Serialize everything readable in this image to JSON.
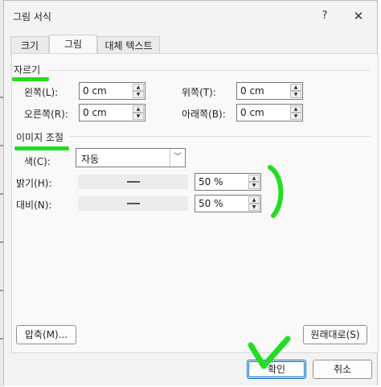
{
  "dialog": {
    "title": "그림 서식",
    "help_label": "?",
    "close_label": "✕"
  },
  "tabs": [
    {
      "label": "크기",
      "active": false
    },
    {
      "label": "그림",
      "active": true
    },
    {
      "label": "대체 텍스트",
      "active": false
    }
  ],
  "crop": {
    "title": "자르기",
    "left_label": "왼쪽(L):",
    "left_value": "0 cm",
    "top_label": "위쪽(T):",
    "top_value": "0 cm",
    "right_label": "오른쪽(R):",
    "right_value": "0 cm",
    "bottom_label": "아래쪽(B):",
    "bottom_value": "0 cm"
  },
  "image_adjust": {
    "title": "이미지 조절",
    "color_label": "색(C):",
    "color_value": "자동",
    "brightness_label": "밝기(H):",
    "brightness_value": "50 %",
    "brightness_level": 0.5,
    "contrast_label": "대비(N):",
    "contrast_value": "50 %",
    "contrast_level": 0.5
  },
  "buttons": {
    "compress": "압축(M)...",
    "reset": "원래대로(S)",
    "ok": "확인",
    "cancel": "취소"
  },
  "colors": {
    "annotation_green": "#22dd22",
    "accent_blue": "#0067c0"
  }
}
